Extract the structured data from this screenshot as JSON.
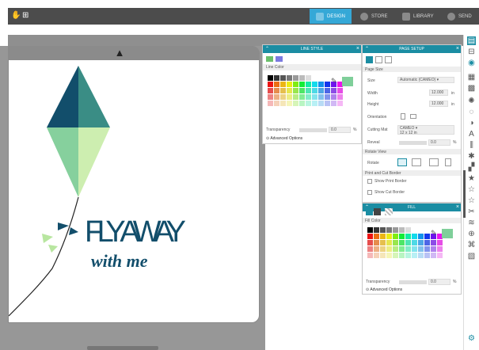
{
  "app": {
    "tabs": [
      {
        "label": "DESIGN",
        "icon": "design-icon",
        "active": true
      },
      {
        "label": "STORE",
        "icon": "store-icon",
        "active": false
      },
      {
        "label": "LIBRARY",
        "icon": "library-icon",
        "active": false
      },
      {
        "label": "SEND",
        "icon": "send-icon",
        "active": false
      }
    ],
    "accent": "#35a8d7"
  },
  "canvas": {
    "text_line1": "FLY AWAY",
    "text_line2": "with me"
  },
  "line_style": {
    "title": "LINE STYLE",
    "line_color_label": "Line Color",
    "transparency_label": "Transparency",
    "transparency_value": "0.0",
    "transparency_unit": "%",
    "advanced": "Advanced Options"
  },
  "page_setup": {
    "title": "PAGE SETUP",
    "page_size_section": "Page Size",
    "size_label": "Size",
    "size_value": "Automatic (CAMEO)",
    "width_label": "Width",
    "width_value": "12.000",
    "width_unit": "in",
    "height_label": "Height",
    "height_value": "12.000",
    "height_unit": "in",
    "orientation_label": "Orientation",
    "cutting_mat_label": "Cutting Mat",
    "cutting_mat_value": "CAMEO",
    "cutting_mat_sub": "12 x 12 in",
    "reveal_label": "Reveal",
    "reveal_value": "0.0",
    "reveal_unit": "%",
    "rotate_view_section": "Rotate View",
    "rotate_label": "Rotate",
    "print_cut_section": "Print and Cut Border",
    "show_print_border": "Show Print Border",
    "show_cut_border": "Show Cut Border"
  },
  "fill": {
    "title": "FILL",
    "fill_color_label": "Fill Color",
    "transparency_label": "Transparency",
    "transparency_value": "0.0",
    "transparency_unit": "%",
    "advanced": "Advanced Options"
  }
}
